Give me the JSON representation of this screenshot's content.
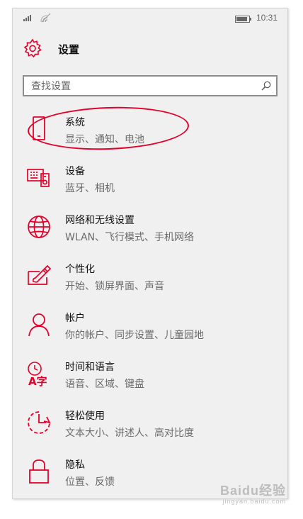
{
  "statusbar": {
    "time": "10:31"
  },
  "header": {
    "title": "设置"
  },
  "search": {
    "placeholder": "查找设置"
  },
  "items": [
    {
      "label": "系统",
      "desc": "显示、通知、电池",
      "icon": "phone-icon"
    },
    {
      "label": "设备",
      "desc": "蓝牙、相机",
      "icon": "devices-icon"
    },
    {
      "label": "网络和无线设置",
      "desc": "WLAN、飞行模式、手机网络",
      "icon": "globe-icon"
    },
    {
      "label": "个性化",
      "desc": "开始、锁屏界面、声音",
      "icon": "personalization-icon"
    },
    {
      "label": "帐户",
      "desc": "你的帐户、同步设置、儿童园地",
      "icon": "person-icon"
    },
    {
      "label": "时间和语言",
      "desc": "语音、区域、键盘",
      "icon": "time-language-icon"
    },
    {
      "label": "轻松使用",
      "desc": "文本大小、讲述人、高对比度",
      "icon": "ease-of-access-icon"
    },
    {
      "label": "隐私",
      "desc": "位置、反馈",
      "icon": "lock-icon"
    }
  ],
  "colors": {
    "accent": "#e4002b",
    "background": "#f0f0f0"
  },
  "watermark": {
    "brand": "Baidu经验",
    "url": "jingyan.baidu.com"
  }
}
